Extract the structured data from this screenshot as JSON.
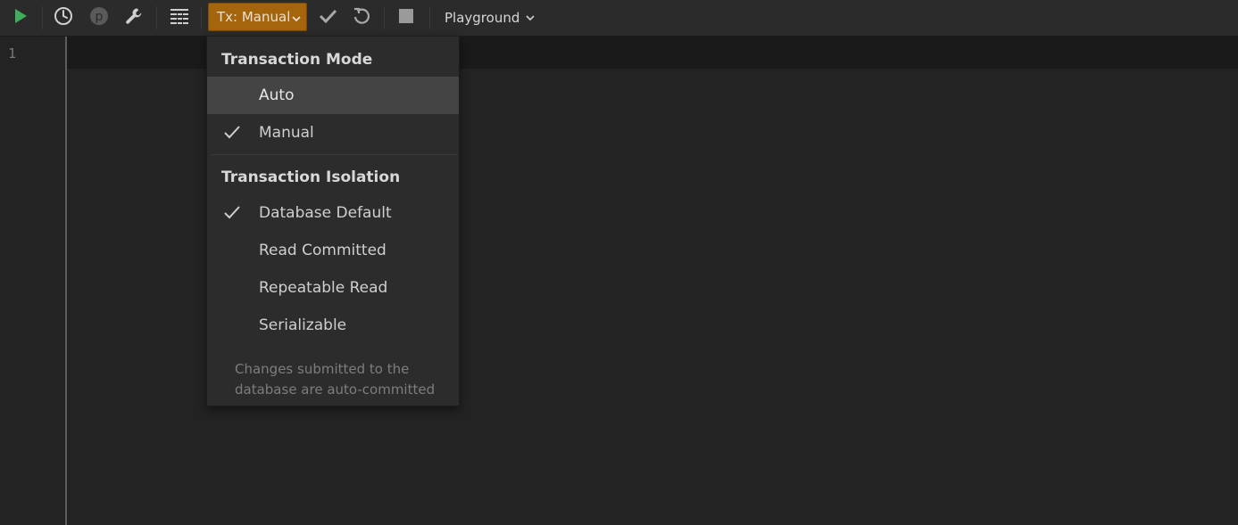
{
  "toolbar": {
    "icons": {
      "run": "play-icon",
      "history": "clock-icon",
      "parameters": "parameter-icon",
      "settings": "wrench-icon",
      "results": "table-rows-icon",
      "commit": "checkmark-icon",
      "rollback": "undo-icon",
      "stop": "stop-icon"
    },
    "tx_button_label": "Tx: Manual",
    "playground_label": "Playground",
    "colors": {
      "run_green": "#3fae5a",
      "tx_accent": "#a4650c"
    }
  },
  "editor": {
    "line_numbers": [
      "1"
    ]
  },
  "tx_menu": {
    "mode_header": "Transaction Mode",
    "mode_items": [
      {
        "label": "Auto",
        "checked": false,
        "highlighted": true
      },
      {
        "label": "Manual",
        "checked": true,
        "highlighted": false
      }
    ],
    "isolation_header": "Transaction Isolation",
    "isolation_items": [
      {
        "label": "Database Default",
        "checked": true
      },
      {
        "label": "Read Committed",
        "checked": false
      },
      {
        "label": "Repeatable Read",
        "checked": false
      },
      {
        "label": "Serializable",
        "checked": false
      }
    ],
    "note": "Changes submitted to the database are auto-committed"
  }
}
